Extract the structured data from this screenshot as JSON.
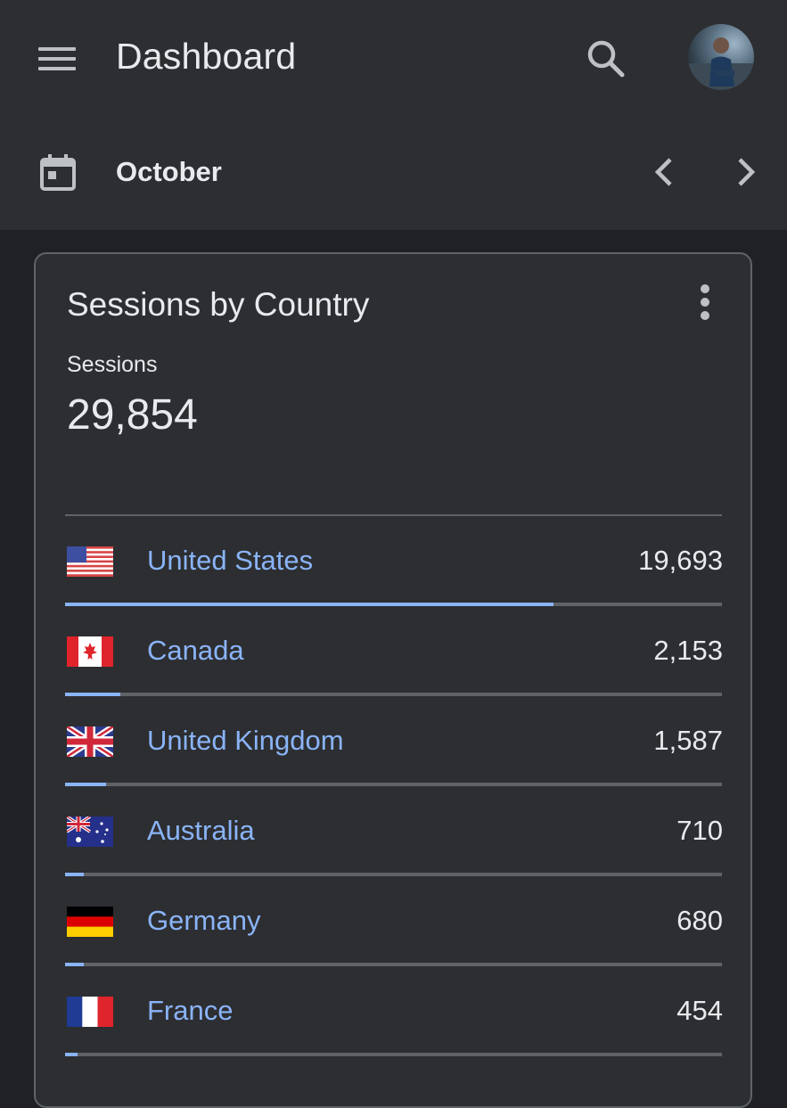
{
  "header": {
    "title": "Dashboard"
  },
  "date_bar": {
    "month": "October"
  },
  "card": {
    "title": "Sessions by Country",
    "metric_label": "Sessions",
    "metric_value": "29,854"
  },
  "countries": [
    {
      "name": "United States",
      "value": "19,693",
      "share": 0.743,
      "flag": "us-flag-icon"
    },
    {
      "name": "Canada",
      "value": "2,153",
      "share": 0.084,
      "flag": "canada-flag-icon"
    },
    {
      "name": "United Kingdom",
      "value": "1,587",
      "share": 0.063,
      "flag": "uk-flag-icon"
    },
    {
      "name": "Australia",
      "value": "710",
      "share": 0.029,
      "flag": "australia-flag-icon"
    },
    {
      "name": "Germany",
      "value": "680",
      "share": 0.028,
      "flag": "germany-flag-icon"
    },
    {
      "name": "France",
      "value": "454",
      "share": 0.019,
      "flag": "france-flag-icon"
    }
  ],
  "colors": {
    "background": "#202124",
    "surface": "#2d2e31",
    "accent": "#8ab4f8",
    "track": "#5f6368",
    "text": "#e8eaed"
  }
}
